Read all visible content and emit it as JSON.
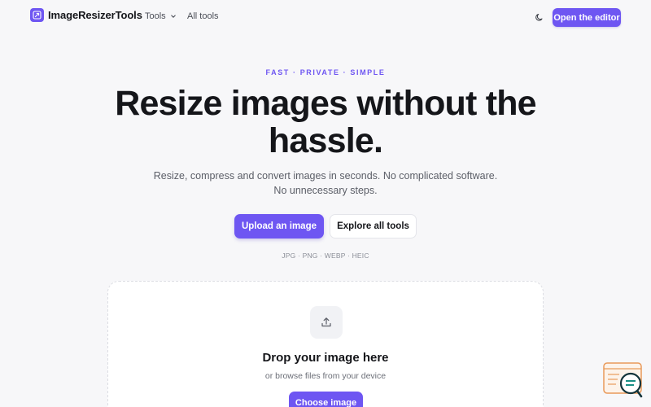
{
  "brand": {
    "name": "ImageResizerTools",
    "accent": "#6e56f2"
  },
  "nav": {
    "tools_label": "Tools",
    "all_tools_label": "All tools",
    "editor_label": "Open the editor"
  },
  "hero": {
    "eyebrow": "FAST · PRIVATE · SIMPLE",
    "headline": "Resize images without the hassle.",
    "sub_line1": "Resize, compress and convert images in seconds. No complicated software.",
    "sub_line2": "No unnecessary steps.",
    "upload_label": "Upload an image",
    "explore_label": "Explore all tools",
    "formats": "JPG · PNG · WEBP · HEIC"
  },
  "dropzone": {
    "title": "Drop your image here",
    "subtitle": "or browse files from your device",
    "choose_label": "Choose image"
  },
  "icons": [
    "logo-icon",
    "chevron-down-icon",
    "moon-icon",
    "upload-icon",
    "help-chat-icon"
  ]
}
